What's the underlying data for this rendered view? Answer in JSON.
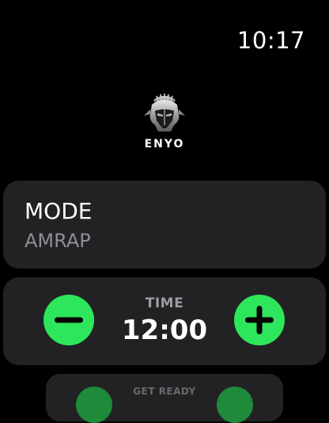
{
  "status_bar": {
    "time": "10:17"
  },
  "brand": {
    "name": "ENYO",
    "logo_icon": "helmet-logo-icon"
  },
  "mode_card": {
    "label": "MODE",
    "value": "AMRAP"
  },
  "time_card": {
    "label": "TIME",
    "value": "12:00",
    "decrease_icon": "minus-icon",
    "increase_icon": "plus-icon"
  },
  "ready_card": {
    "label": "GET READY"
  },
  "colors": {
    "background": "#000000",
    "card": "#222224",
    "accent_green": "#2ee65b",
    "secondary_text": "#8f8f94"
  }
}
